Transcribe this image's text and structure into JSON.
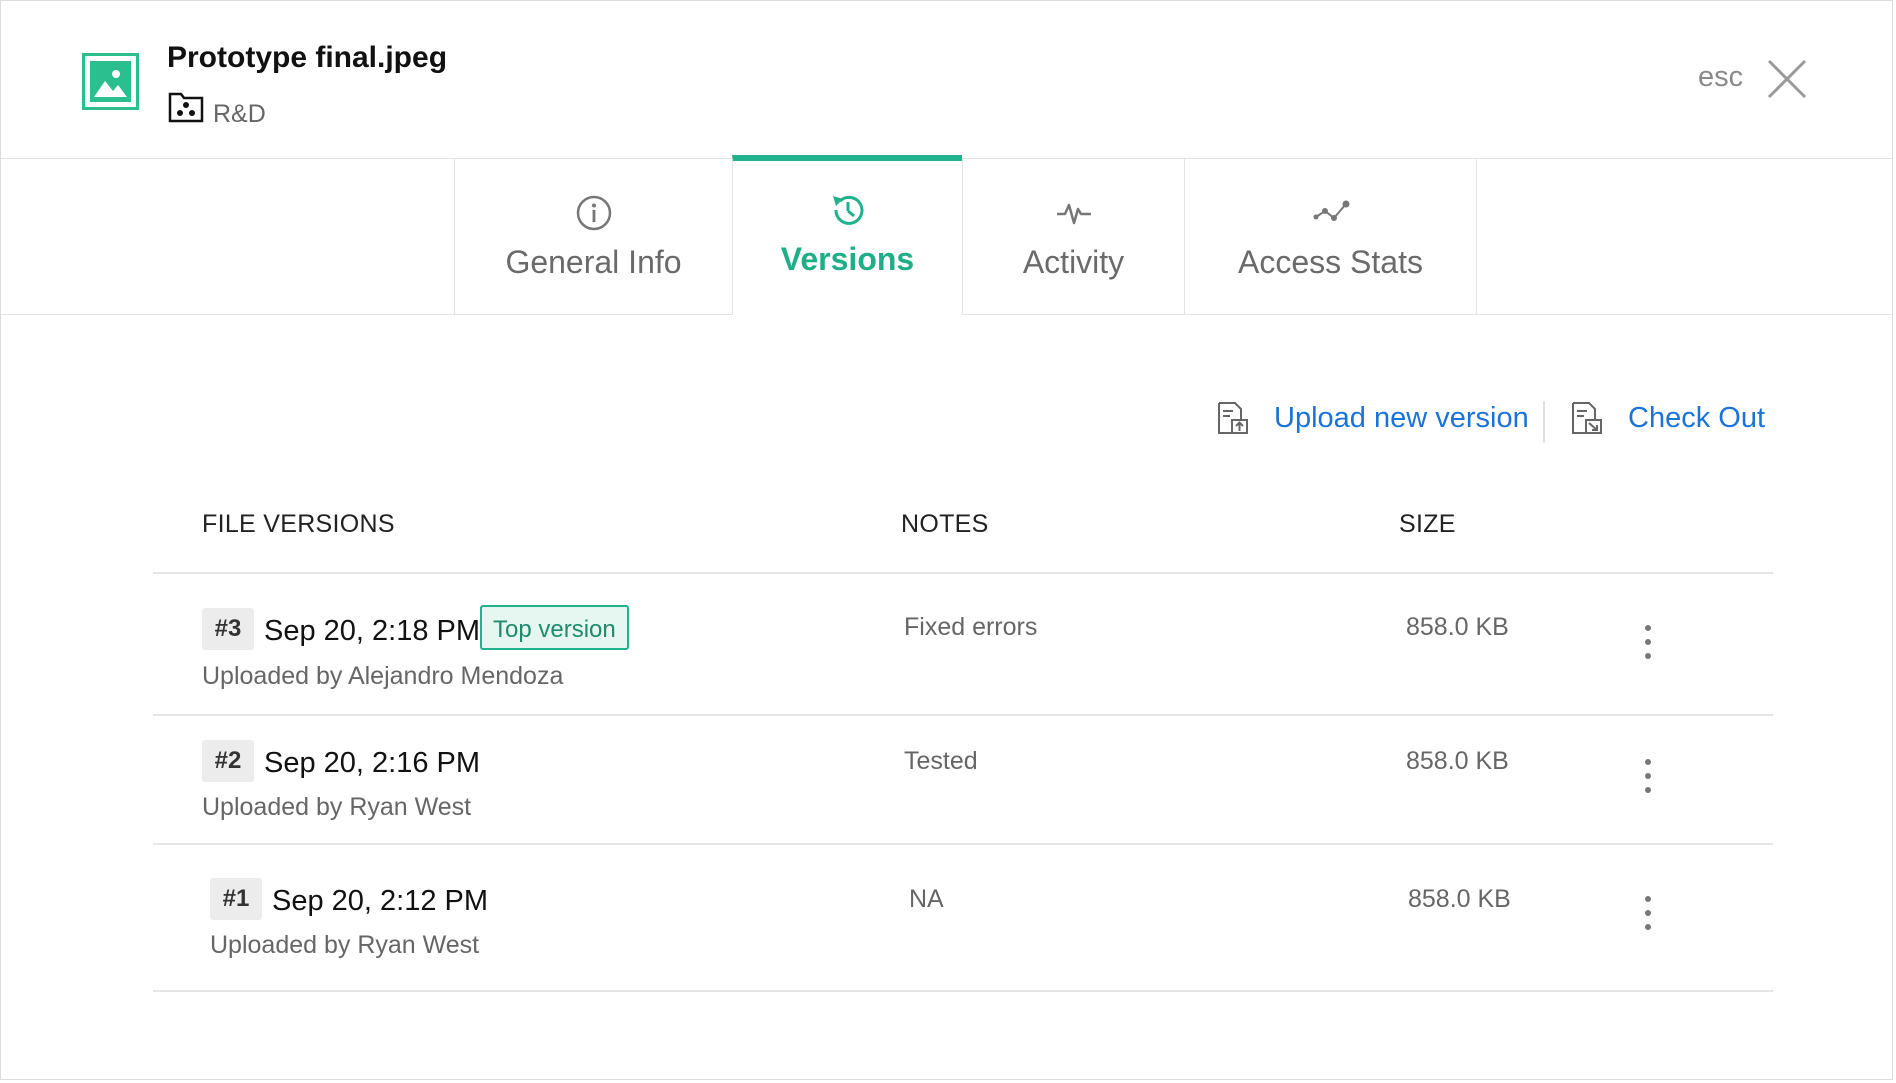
{
  "header": {
    "title": "Prototype final.jpeg",
    "folder": "R&D",
    "esc_label": "esc"
  },
  "tabs": [
    {
      "label": "General Info",
      "icon": "info-icon",
      "active": false
    },
    {
      "label": "Versions",
      "icon": "history-icon",
      "active": true
    },
    {
      "label": "Activity",
      "icon": "pulse-icon",
      "active": false
    },
    {
      "label": "Access Stats",
      "icon": "stats-icon",
      "active": false
    }
  ],
  "actions": {
    "upload_label": "Upload new version",
    "checkout_label": "Check Out"
  },
  "table": {
    "headers": {
      "versions": "FILE VERSIONS",
      "notes": "NOTES",
      "size": "SIZE"
    },
    "rows": [
      {
        "number": "#3",
        "date": "Sep 20, 2:18 PM",
        "tag": "Top version",
        "uploader": "Uploaded by Alejandro Mendoza",
        "notes": "Fixed errors",
        "size": "858.0 KB"
      },
      {
        "number": "#2",
        "date": "Sep 20, 2:16 PM",
        "uploader": "Uploaded by Ryan West",
        "notes": "Tested",
        "size": "858.0 KB"
      },
      {
        "number": "#1",
        "date": "Sep 20, 2:12 PM",
        "uploader": "Uploaded by Ryan West",
        "notes": "NA",
        "size": "858.0 KB"
      }
    ]
  },
  "colors": {
    "accent_green": "#1fb28c",
    "link_blue": "#1a73d9",
    "top_version_bg": "#e6f7f2"
  }
}
